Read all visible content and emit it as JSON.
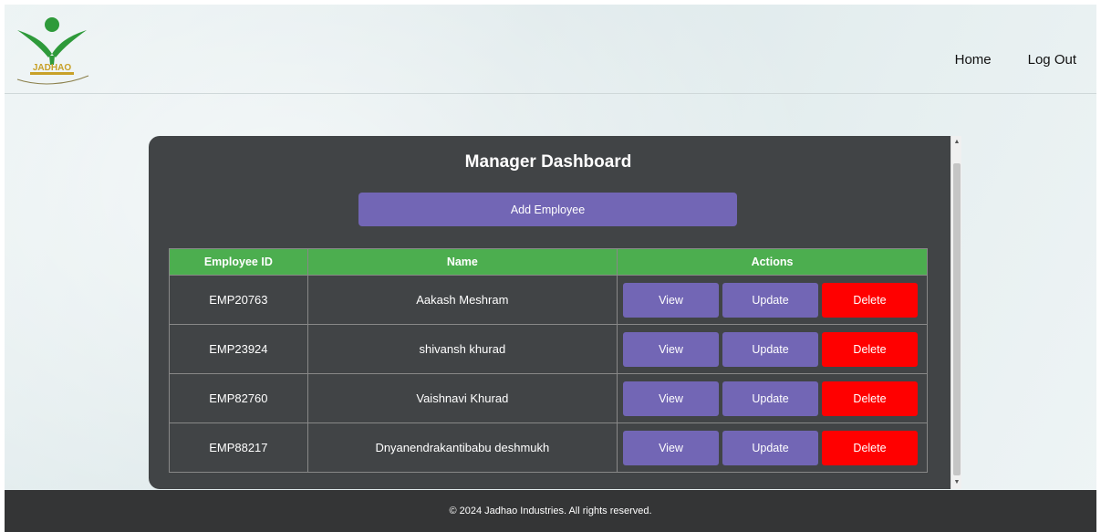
{
  "header": {
    "nav": {
      "home": "Home",
      "logout": "Log Out"
    },
    "logo_text": "JADHAO"
  },
  "dashboard": {
    "title": "Manager Dashboard",
    "add_button": "Add Employee",
    "columns": [
      "Employee ID",
      "Name",
      "Actions"
    ],
    "rows": [
      {
        "id": "EMP20763",
        "name": "Aakash Meshram"
      },
      {
        "id": "EMP23924",
        "name": "shivansh khurad"
      },
      {
        "id": "EMP82760",
        "name": "Vaishnavi Khurad"
      },
      {
        "id": "EMP88217",
        "name": "Dnyanendrakantibabu deshmukh"
      }
    ],
    "actions": {
      "view": "View",
      "update": "Update",
      "delete": "Delete"
    }
  },
  "footer": {
    "text": "© 2024 Jadhao Industries. All rights reserved."
  },
  "colors": {
    "accent": "#7266b5",
    "header_green": "#4cae4f",
    "delete_red": "#ff0000",
    "panel": "#414446"
  },
  "icons": [
    "logo-icon",
    "scroll-up-icon",
    "scroll-down-icon"
  ]
}
